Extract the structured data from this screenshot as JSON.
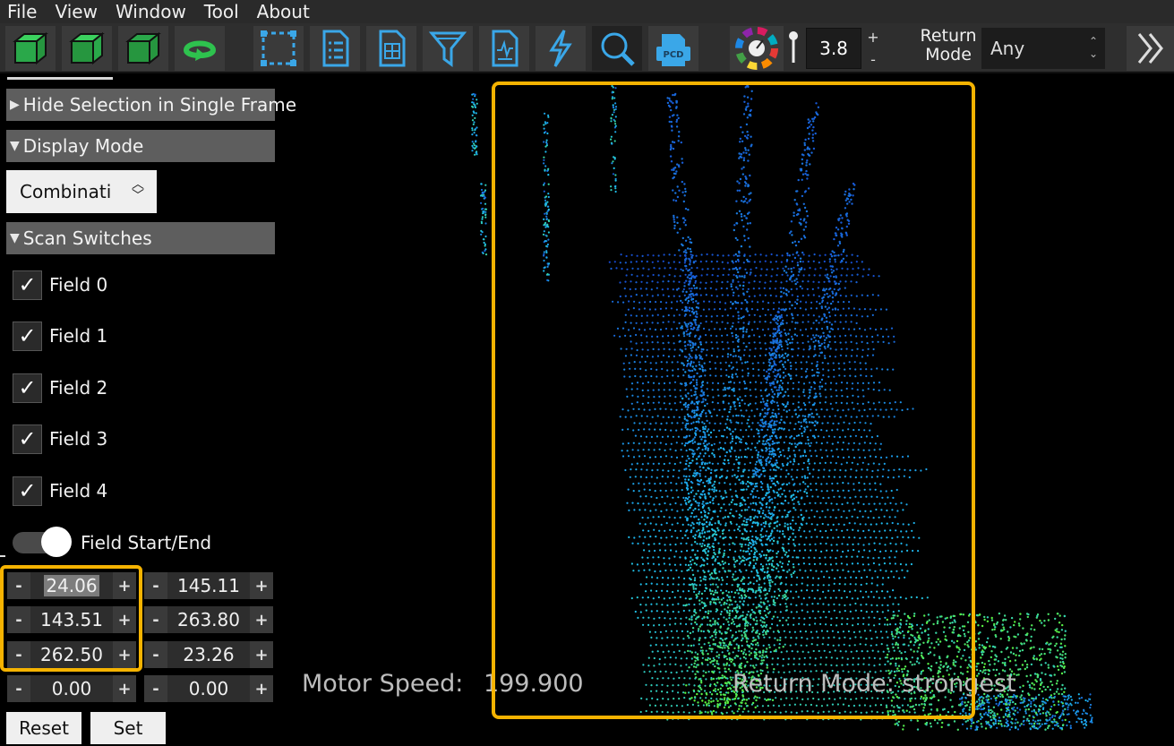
{
  "menu": {
    "items": [
      "File",
      "View",
      "Window",
      "Tool",
      "About"
    ]
  },
  "toolbar": {
    "buttons": [
      {
        "icon": "cube-front-view-icon"
      },
      {
        "icon": "cube-side-view-icon"
      },
      {
        "icon": "cube-top-view-icon"
      },
      {
        "icon": "rotate-view-icon"
      },
      {
        "icon": "selection-rect-icon"
      },
      {
        "icon": "document-list-icon"
      },
      {
        "icon": "document-grid-icon"
      },
      {
        "icon": "filter-icon"
      },
      {
        "icon": "document-chart-icon"
      },
      {
        "icon": "lightning-icon"
      },
      {
        "icon": "magnifier-icon"
      },
      {
        "icon": "pcd-file-icon"
      },
      {
        "icon": "color-wheel-icon"
      },
      {
        "icon": "point-size-icon"
      }
    ],
    "pcd_label": "PCD",
    "point_size": "3.8",
    "plus": "+",
    "minus": "-",
    "return_mode_label_1": "Return",
    "return_mode_label_2": "Mode",
    "return_mode_value": "Any",
    "accent": "#f5b301"
  },
  "panel": {
    "hide_selection": "Hide Selection in Single Frame",
    "display_mode": "Display Mode",
    "display_mode_value": "Combinati",
    "scan_switches": "Scan Switches",
    "fields": [
      {
        "label": "Field 0",
        "checked": true
      },
      {
        "label": "Field 1",
        "checked": true
      },
      {
        "label": "Field 2",
        "checked": true
      },
      {
        "label": "Field 3",
        "checked": true
      },
      {
        "label": "Field 4",
        "checked": true
      }
    ],
    "check_mark": "✓",
    "toggle_label": "Field Start/End",
    "steppers": [
      [
        "24.06",
        "145.11"
      ],
      [
        "143.51",
        "263.80"
      ],
      [
        "262.50",
        "23.26"
      ],
      [
        "0.00",
        "0.00"
      ]
    ],
    "reset_label": "Reset",
    "set_label": "Set"
  },
  "viewport": {
    "motor_speed_label": "Motor Speed:",
    "motor_speed_value": "199.900",
    "return_mode_text": "Return Mode: strongest"
  }
}
